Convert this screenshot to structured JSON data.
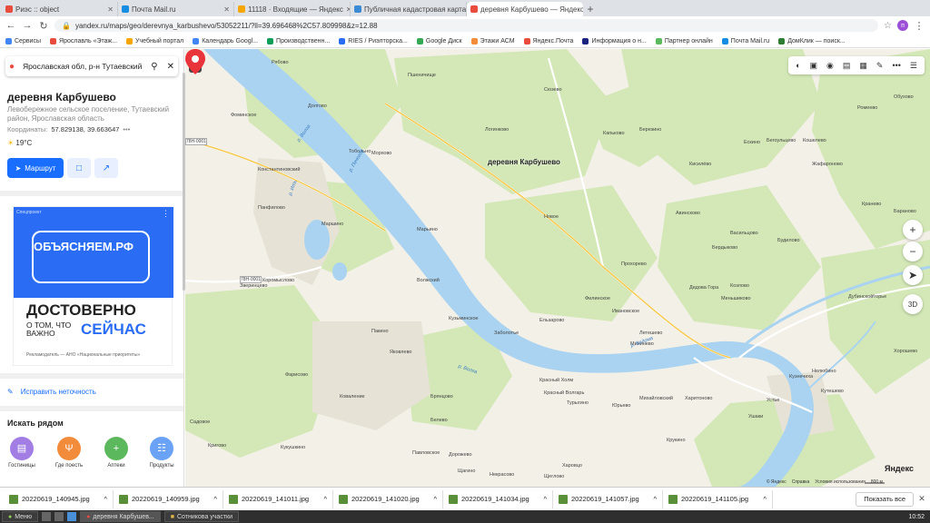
{
  "browser": {
    "tabs": [
      {
        "title": "Риэс :: object",
        "color": "#e84c3d"
      },
      {
        "title": "Почта Mail.ru",
        "color": "#168de2"
      },
      {
        "title": "11118 · Входящие — Яндекс",
        "color": "#f7a600"
      },
      {
        "title": "Публичная кадастровая карта",
        "color": "#3b8bd4"
      },
      {
        "title": "деревня Карбушево — Яндекс",
        "color": "#e84c3d"
      }
    ],
    "new_tab": "+",
    "url": "yandex.ru/maps/geo/derevnya_karbushevo/53052211/?ll=39.696468%2C57.809998&z=12.88",
    "profile_letter": "п",
    "bookmarks": [
      "Сервисы",
      "Ярославль «Этаж...",
      "Учебный портал",
      "Календарь Googl...",
      "Производственн...",
      "RIES / Риэлторска...",
      "Google Диск",
      "Этажи АСМ",
      "Яндекс.Почта",
      "Информация о н...",
      "Партнер онлайн",
      "Почта Mail.ru",
      "ДомКлик — поиск..."
    ]
  },
  "panel": {
    "search": "Ярославская обл, р-н Тутаевский",
    "title": "деревня Карбушево",
    "subtitle": "Левобережное сельское поселение, Тутаевский район, Ярославская область",
    "coords_label": "Координаты:",
    "coords_value": "57.829138, 39.663647",
    "weather": "19°C",
    "route_label": "Маршрут",
    "ad": {
      "label": "Спецпроект",
      "brand": "ОБЪЯСНЯЕМ.РФ",
      "headline": "ДОСТОВЕРНО",
      "small": "О ТОМ, ЧТО ВАЖНО",
      "accent": "СЕЙЧАС",
      "footer": "Рекламодатель — АНО «Национальные приоритеты»"
    },
    "fix_label": "Исправить неточность",
    "nearby_title": "Искать рядом",
    "nearby": [
      {
        "label": "Гостиницы",
        "color": "#a27de4",
        "icon": "bed-icon"
      },
      {
        "label": "Где поесть",
        "color": "#f28b3a",
        "icon": "fork-icon"
      },
      {
        "label": "Аптеки",
        "color": "#5cb85c",
        "icon": "cross-icon"
      },
      {
        "label": "Продукты",
        "color": "#6aa3f5",
        "icon": "basket-icon"
      }
    ]
  },
  "map": {
    "marker_label": "деревня Карбушево",
    "places": [
      "Рябово",
      "Пшеничище",
      "Фоминское",
      "Долгово",
      "Логинково",
      "Сюзево",
      "Капьково",
      "Березино",
      "Ескино",
      "Бегоульцево",
      "Кошелево",
      "Обухово",
      "Тобольно",
      "Морхово",
      "Константиновский",
      "Кисилёво",
      "Жафароново",
      "Панфилово",
      "Маршино",
      "Марьино",
      "Новое",
      "Авинсково",
      "Васильцово",
      "Будилово",
      "Коромыслово",
      "Волжский",
      "Прохорево",
      "Бердыково",
      "Козлово",
      "Дедова Гора",
      "Меньшиково",
      "Зверинцево",
      "Филинское",
      "Ивановское",
      "Дубинское",
      "Кузьминское",
      "Ельзарово",
      "Заболотье",
      "Летешево",
      "Мининево",
      "Пакино",
      "Яковлево",
      "Красный Холм",
      "Красный Волгарь",
      "Михайловский",
      "Турыгино",
      "Харитоново",
      "Юрьево",
      "Фарисово",
      "Коваление",
      "Брянцово",
      "Белево",
      "Садовое",
      "Кригово",
      "Кукушкино",
      "Павловское",
      "Дорожево",
      "Щагино",
      "Харовцо",
      "Некрасово",
      "Щеглово",
      "Крукино",
      "Ушаки",
      "Устье",
      "Кузнечиха",
      "Кутешево",
      "Нелюбино",
      "Хорошево",
      "Угорье",
      "Кранево",
      "Бараново",
      "Ромеево"
    ],
    "rivers": [
      "р. Волга",
      "р. Волга",
      "р. Печегда",
      "р. Ить",
      "р. Ведома"
    ],
    "roads": [
      "78Н-0001",
      "78Н-0001"
    ],
    "logo": "Яндекс",
    "copyright": [
      "© Яндекс",
      "Справка",
      "Условия использования"
    ],
    "scale": "800 м",
    "zoom_in": "+",
    "zoom_out": "−",
    "view_3d": "3D"
  },
  "downloads": {
    "files": [
      "20220619_140945.jpg",
      "20220619_140959.jpg",
      "20220619_141011.jpg",
      "20220619_141020.jpg",
      "20220619_141034.jpg",
      "20220619_141057.jpg",
      "20220619_141105.jpg"
    ],
    "show_all": "Показать все",
    "close": "✕"
  },
  "taskbar": {
    "menu": "Меню",
    "tasks": [
      "деревня Карбушев...",
      "Сотникова участки"
    ],
    "clock": "10:52"
  }
}
